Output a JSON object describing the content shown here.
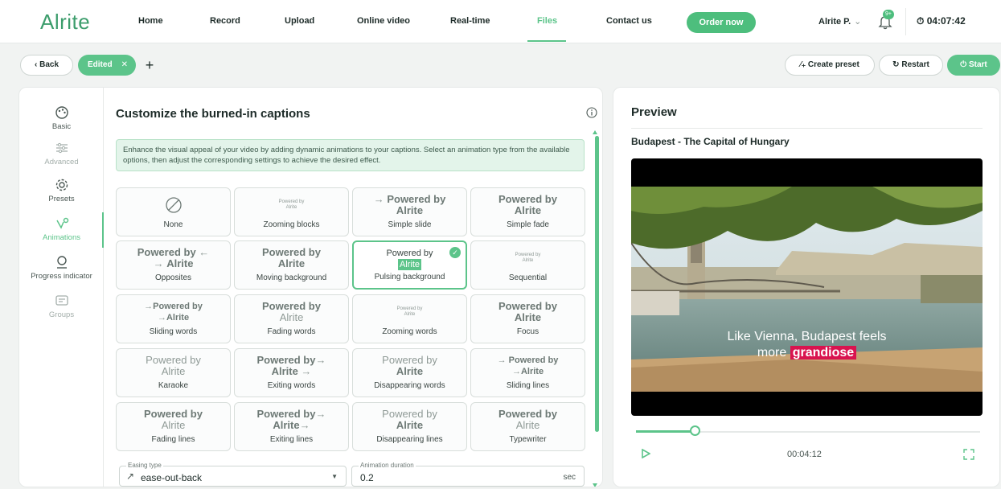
{
  "nav": {
    "logo": "Alrite",
    "items": [
      "Home",
      "Record",
      "Upload",
      "Online video",
      "Real-time",
      "Files",
      "Contact us"
    ],
    "active": "Files",
    "order_label": "Order now",
    "user_label": "Alrite P.",
    "notification_badge": "9+",
    "timer": "04:07:42"
  },
  "toolbar": {
    "back_label": "Back",
    "tab_label": "Edited",
    "create_preset_label": "Create preset",
    "restart_label": "Restart",
    "start_label": "Start"
  },
  "sidebar": {
    "items": [
      {
        "label": "Basic",
        "icon": "palette-icon",
        "state": "normal"
      },
      {
        "label": "Advanced",
        "icon": "sliders-icon",
        "state": "disabled"
      },
      {
        "label": "Presets",
        "icon": "gear-icon",
        "state": "normal"
      },
      {
        "label": "Animations",
        "icon": "animation-icon",
        "state": "active"
      },
      {
        "label": "Progress indicator",
        "icon": "progress-icon",
        "state": "normal"
      },
      {
        "label": "Groups",
        "icon": "groups-icon",
        "state": "disabled"
      }
    ]
  },
  "main": {
    "title": "Customize the burned-in captions",
    "banner": "Enhance the visual appeal of your video by adding dynamic animations to your captions. Select an animation type from the available options, then adjust the corresponding settings to achieve the desired effect.",
    "preview_line1": "Powered by",
    "preview_line2": "Alrite",
    "animations": [
      "None",
      "Zooming blocks",
      "Simple slide",
      "Simple fade",
      "Opposites",
      "Moving background",
      "Pulsing background",
      "Sequential",
      "Sliding words",
      "Fading words",
      "Zooming words",
      "Focus",
      "Karaoke",
      "Exiting words",
      "Disappearing words",
      "Sliding lines",
      "Fading lines",
      "Exiting lines",
      "Disappearing lines",
      "Typewriter"
    ],
    "selected": "Pulsing background",
    "easing": {
      "label": "Easing type",
      "value": "ease-out-back"
    },
    "duration": {
      "label": "Animation duration",
      "value": "0.2",
      "unit": "sec"
    }
  },
  "preview": {
    "title": "Preview",
    "video_title": "Budapest - The Capital of Hungary",
    "subtitle_line1": "Like Vienna, Budapest feels",
    "subtitle_plain": "more",
    "subtitle_highlight": "grandiose",
    "time": "00:04:12",
    "progress": 0.17
  },
  "colors": {
    "accent": "#5cc48a",
    "highlight": "#d9134f"
  }
}
